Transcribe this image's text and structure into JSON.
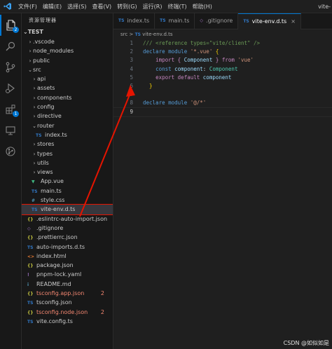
{
  "titlebar": {
    "menus": [
      "文件(F)",
      "编辑(E)",
      "选择(S)",
      "查看(V)",
      "转到(G)",
      "运行(R)",
      "终端(T)",
      "帮助(H)"
    ],
    "window_title": "vite-"
  },
  "activity": {
    "explorer_badge": "2",
    "extensions_badge": "1"
  },
  "explorer": {
    "header": "资源管理器",
    "root": "TEST",
    "items": [
      {
        "label": ".vscode",
        "kind": "folder",
        "depth": 1,
        "open": false
      },
      {
        "label": "node_modules",
        "kind": "folder",
        "depth": 1,
        "open": false
      },
      {
        "label": "public",
        "kind": "folder",
        "depth": 1,
        "open": false
      },
      {
        "label": "src",
        "kind": "folder",
        "depth": 1,
        "open": true
      },
      {
        "label": "api",
        "kind": "folder",
        "depth": 2,
        "open": false
      },
      {
        "label": "assets",
        "kind": "folder",
        "depth": 2,
        "open": false
      },
      {
        "label": "components",
        "kind": "folder",
        "depth": 2,
        "open": false
      },
      {
        "label": "config",
        "kind": "folder",
        "depth": 2,
        "open": false
      },
      {
        "label": "directive",
        "kind": "folder",
        "depth": 2,
        "open": false
      },
      {
        "label": "router",
        "kind": "folder",
        "depth": 2,
        "open": true
      },
      {
        "label": "index.ts",
        "kind": "ts",
        "depth": 3
      },
      {
        "label": "stores",
        "kind": "folder",
        "depth": 2,
        "open": false
      },
      {
        "label": "types",
        "kind": "folder",
        "depth": 2,
        "open": false
      },
      {
        "label": "utils",
        "kind": "folder",
        "depth": 2,
        "open": false
      },
      {
        "label": "views",
        "kind": "folder",
        "depth": 2,
        "open": false
      },
      {
        "label": "App.vue",
        "kind": "vue",
        "depth": 2
      },
      {
        "label": "main.ts",
        "kind": "ts",
        "depth": 2
      },
      {
        "label": "style.css",
        "kind": "css",
        "depth": 2
      },
      {
        "label": "vite-env.d.ts",
        "kind": "ts",
        "depth": 2,
        "highlight": true
      },
      {
        "label": ".eslintrc-auto-import.json",
        "kind": "json",
        "depth": 1
      },
      {
        "label": ".gitignore",
        "kind": "git",
        "depth": 1
      },
      {
        "label": ".prettierrc.json",
        "kind": "json",
        "depth": 1
      },
      {
        "label": "auto-imports.d.ts",
        "kind": "ts",
        "depth": 1
      },
      {
        "label": "index.html",
        "kind": "html",
        "depth": 1
      },
      {
        "label": "package.json",
        "kind": "json",
        "depth": 1
      },
      {
        "label": "pnpm-lock.yaml",
        "kind": "yaml",
        "depth": 1
      },
      {
        "label": "README.md",
        "kind": "md",
        "depth": 1
      },
      {
        "label": "tsconfig.app.json",
        "kind": "json",
        "depth": 1,
        "error": true,
        "count": "2"
      },
      {
        "label": "tsconfig.json",
        "kind": "tsconfig",
        "depth": 1
      },
      {
        "label": "tsconfig.node.json",
        "kind": "json",
        "depth": 1,
        "error": true,
        "count": "2"
      },
      {
        "label": "vite.config.ts",
        "kind": "ts",
        "depth": 1
      }
    ]
  },
  "tabs": [
    {
      "label": "index.ts",
      "icon": "TS",
      "active": false
    },
    {
      "label": "main.ts",
      "icon": "TS",
      "active": false
    },
    {
      "label": ".gitignore",
      "icon": "git",
      "active": false
    },
    {
      "label": "vite-env.d.ts",
      "icon": "TS",
      "active": true
    }
  ],
  "tab_close": "×",
  "breadcrumb": {
    "folder": "src",
    "separator": ">",
    "file_icon": "TS",
    "file": "vite-env.d.ts"
  },
  "code": [
    {
      "n": "1",
      "tokens": [
        [
          "c",
          "/// <reference types=\"vite/client\" />"
        ]
      ]
    },
    {
      "n": "2",
      "tokens": [
        [
          "k",
          "declare module "
        ],
        [
          "s",
          "'*.vue'"
        ],
        [
          "y",
          " {"
        ]
      ]
    },
    {
      "n": "3",
      "tokens": [
        [
          "p",
          "    "
        ],
        [
          "kp",
          "import"
        ],
        [
          "p",
          " "
        ],
        [
          "kp",
          "{ "
        ],
        [
          "v",
          "Component"
        ],
        [
          "kp",
          " }"
        ],
        [
          "p",
          " "
        ],
        [
          "kp",
          "from"
        ],
        [
          "p",
          " "
        ],
        [
          "s",
          "'vue'"
        ]
      ]
    },
    {
      "n": "4",
      "tokens": [
        [
          "p",
          "    "
        ],
        [
          "k",
          "const"
        ],
        [
          "p",
          " "
        ],
        [
          "v",
          "component"
        ],
        [
          "p",
          ": "
        ],
        [
          "t",
          "Component"
        ]
      ]
    },
    {
      "n": "5",
      "tokens": [
        [
          "p",
          "    "
        ],
        [
          "kp",
          "export default"
        ],
        [
          "p",
          " "
        ],
        [
          "v",
          "component"
        ]
      ]
    },
    {
      "n": "6",
      "tokens": [
        [
          "y",
          "  }"
        ]
      ]
    },
    {
      "n": "7",
      "tokens": []
    },
    {
      "n": "8",
      "tokens": [
        [
          "k",
          "declare module "
        ],
        [
          "s",
          "'@/*'"
        ]
      ]
    },
    {
      "n": "9",
      "tokens": [],
      "current": true
    }
  ],
  "watermark": "CSDN @如似如是",
  "colors": {
    "accent": "#0078d4",
    "annotation_red": "#e51400",
    "error_text": "#f48771"
  }
}
